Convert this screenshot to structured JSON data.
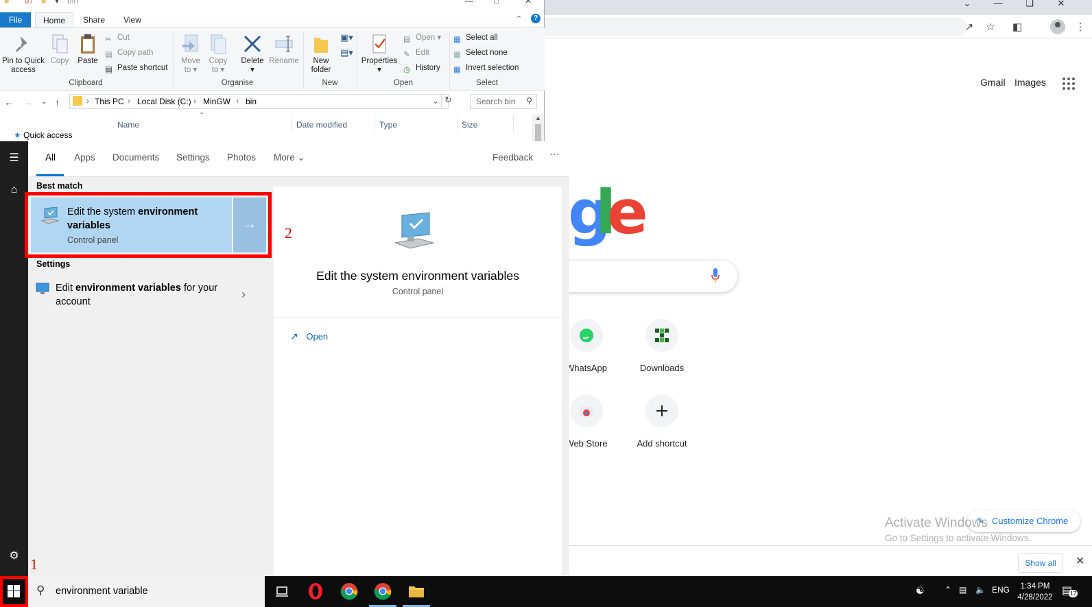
{
  "explorer": {
    "title": "bin",
    "tabs": {
      "file": "File",
      "home": "Home",
      "share": "Share",
      "view": "View"
    },
    "clipboard": {
      "pin_line1": "Pin to Quick",
      "pin_line2": "access",
      "copy": "Copy",
      "paste": "Paste",
      "cut": "Cut",
      "copy_path": "Copy path",
      "paste_shortcut": "Paste shortcut",
      "group": "Clipboard"
    },
    "organise": {
      "move_line1": "Move",
      "move_line2": "to",
      "copy_line1": "Copy",
      "copy_line2": "to",
      "delete": "Delete",
      "rename": "Rename",
      "group": "Organise"
    },
    "new": {
      "folder_line1": "New",
      "folder_line2": "folder",
      "group": "New"
    },
    "open": {
      "properties": "Properties",
      "open": "Open",
      "edit": "Edit",
      "history": "History",
      "group": "Open"
    },
    "select": {
      "all": "Select all",
      "none": "Select none",
      "invert": "Invert selection",
      "group": "Select"
    },
    "breadcrumbs": [
      "This PC",
      "Local Disk (C:)",
      "MinGW",
      "bin"
    ],
    "search_placeholder": "Search bin",
    "columns": {
      "name": "Name",
      "date": "Date modified",
      "type": "Type",
      "size": "Size"
    },
    "nav": {
      "quick_access": "Quick access"
    }
  },
  "chrome": {
    "links": {
      "gmail": "Gmail",
      "images": "Images"
    },
    "logo_fragment": [
      "g",
      "l",
      "e"
    ],
    "logo_colors": [
      "#4285f4",
      "#34a853",
      "#ea4335"
    ],
    "shortcuts": [
      {
        "label": "WhatsApp",
        "icon": "whatsapp-icon"
      },
      {
        "label": "Downloads",
        "icon": "downloads-site-icon"
      },
      {
        "label": "Web Store",
        "icon": "webstore-icon"
      },
      {
        "label": "Add shortcut",
        "icon": "plus-icon"
      }
    ],
    "customize": "Customize Chrome",
    "watermark_line1": "Activate Windows",
    "watermark_line2": "Go to Settings to activate Windows.",
    "show_all": "Show all"
  },
  "search": {
    "tabs": [
      "All",
      "Apps",
      "Documents",
      "Settings",
      "Photos",
      "More"
    ],
    "feedback": "Feedback",
    "more_dots": "···",
    "best_match_label": "Best match",
    "best_match": {
      "title_plain": "Edit the system ",
      "title_bold": "environment",
      "title_bold2": "variables",
      "subtitle": "Control panel"
    },
    "settings_label": "Settings",
    "settings_item": {
      "pre": "Edit ",
      "bold": "environment variables",
      "post": " for your account"
    },
    "detail": {
      "title": "Edit the system environment variables",
      "subtitle": "Control panel",
      "open": "Open"
    },
    "query": "environment variable"
  },
  "annotations": {
    "step1": "1",
    "step2": "2"
  },
  "taskbar": {
    "time": "1:34 PM",
    "date": "4/28/2022",
    "lang": "ENG",
    "notifications": "17"
  },
  "colors": {
    "accent": "#0078d7",
    "highlight": "#ff0000",
    "selected": "#b1d6f2"
  }
}
